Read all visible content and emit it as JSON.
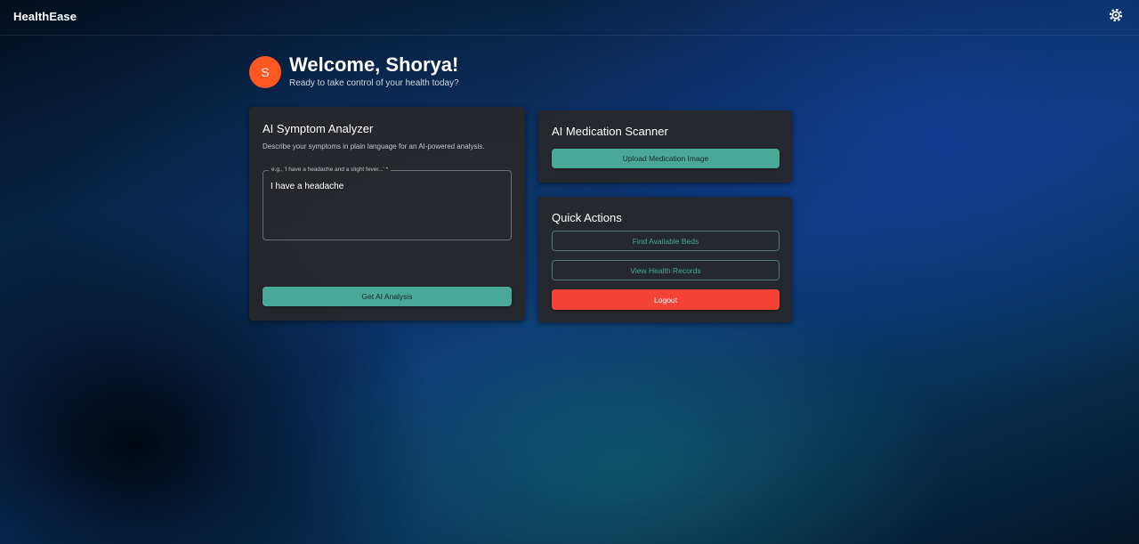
{
  "app": {
    "brand": "HealthEase",
    "settings_icon": "gear-icon"
  },
  "welcome": {
    "avatar_initial": "S",
    "title": "Welcome, Shorya!",
    "subtitle": "Ready to take control of your health today?"
  },
  "symptom_analyzer": {
    "title": "AI Symptom Analyzer",
    "description": "Describe your symptoms in plain language for an AI-powered analysis.",
    "input_label": "e.g., 'I have a headache and a slight fever...' *",
    "input_value": "I have a headache",
    "submit_label": "Get AI Analysis"
  },
  "medication_scanner": {
    "title": "AI Medication Scanner",
    "upload_label": "Upload Medication Image"
  },
  "quick_actions": {
    "title": "Quick Actions",
    "find_beds_label": "Find Available Beds",
    "health_records_label": "View Health Records",
    "logout_label": "Logout"
  },
  "colors": {
    "avatar": "#ff5722",
    "accent_teal": "#4aa896",
    "logout_red": "#f44336",
    "card_bg": "#26282b"
  }
}
